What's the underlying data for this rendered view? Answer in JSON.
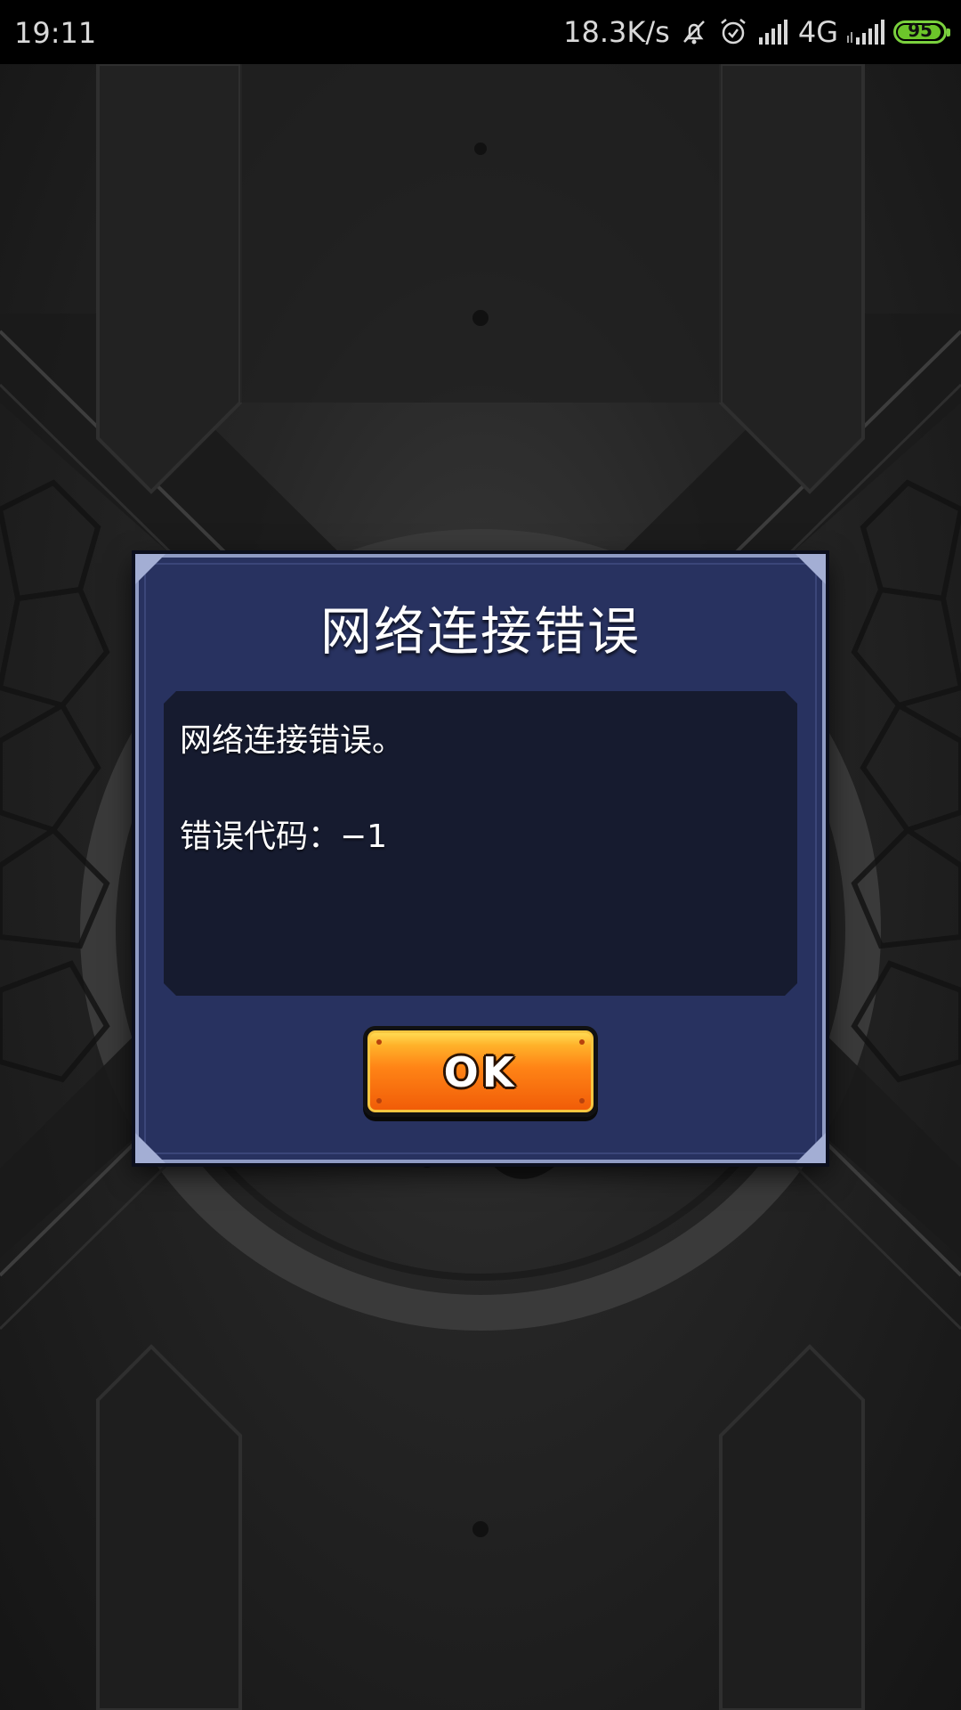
{
  "status_bar": {
    "time": "19:11",
    "net_speed": "18.3K/s",
    "network_type": "4G",
    "battery_level": "95",
    "icons": [
      "notifications-muted-icon",
      "alarm-icon",
      "signal-icon",
      "signal-icon"
    ]
  },
  "dialog": {
    "title": "网络连接错误",
    "message_line1": "网络连接错误。",
    "message_line2": "错误代码：−1",
    "ok_label": "OK"
  },
  "colors": {
    "dialog_bg": "#283260",
    "message_bg": "#161b2f",
    "button_orange": "#f05a07",
    "battery_green": "#6cc52a"
  }
}
